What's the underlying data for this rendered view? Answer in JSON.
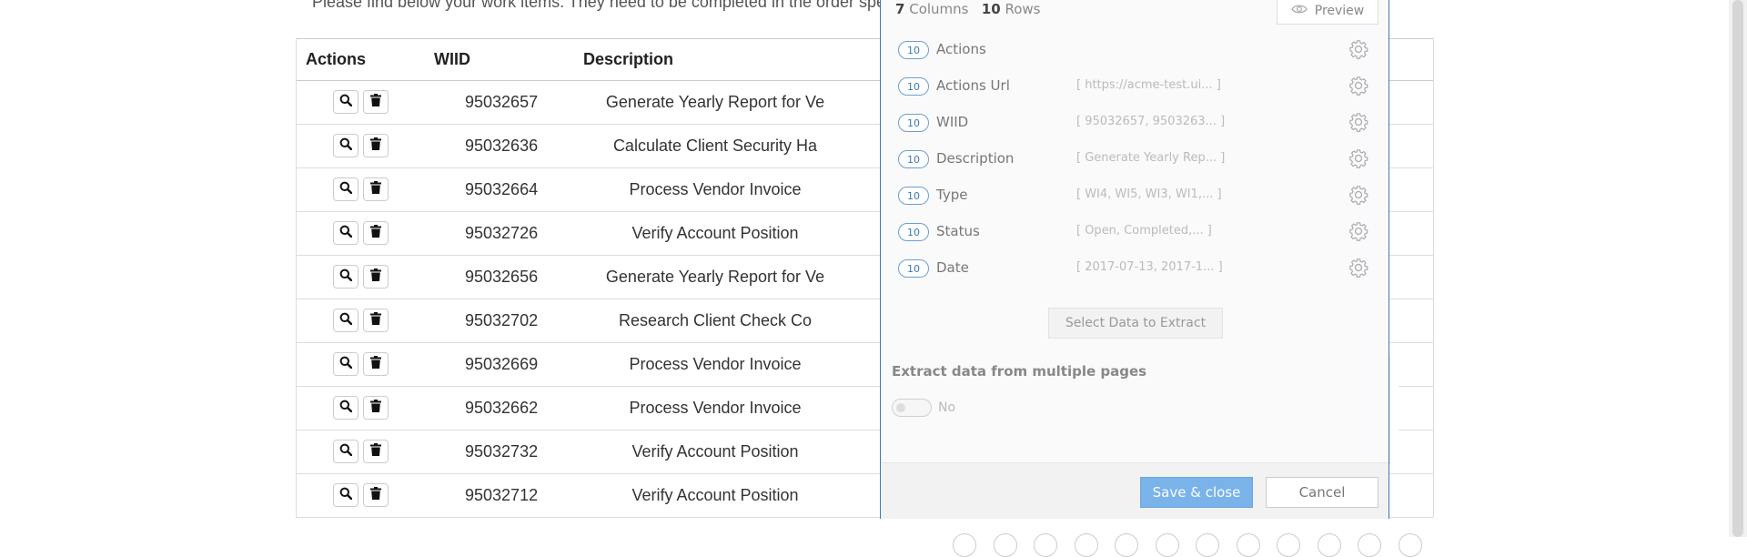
{
  "page": {
    "intro": "Please find below your work items. They need to be completed in the order spec"
  },
  "table": {
    "headers": {
      "actions": "Actions",
      "wiid": "WIID",
      "description": "Description"
    },
    "rows": [
      {
        "wiid": "95032657",
        "description": "Generate Yearly Report for Ve"
      },
      {
        "wiid": "95032636",
        "description": "Calculate Client Security Ha"
      },
      {
        "wiid": "95032664",
        "description": "Process Vendor Invoice"
      },
      {
        "wiid": "95032726",
        "description": "Verify Account Position"
      },
      {
        "wiid": "95032656",
        "description": "Generate Yearly Report for Ve"
      },
      {
        "wiid": "95032702",
        "description": "Research Client Check Co"
      },
      {
        "wiid": "95032669",
        "description": "Process Vendor Invoice"
      },
      {
        "wiid": "95032662",
        "description": "Process Vendor Invoice"
      },
      {
        "wiid": "95032732",
        "description": "Verify Account Position"
      },
      {
        "wiid": "95032712",
        "description": "Verify Account Position"
      }
    ],
    "view_icon": "search-icon",
    "delete_icon": "trash-icon"
  },
  "modal": {
    "columns_count": "7",
    "columns_label": "Columns",
    "rows_count": "10",
    "rows_label": "Rows",
    "preview_label": "Preview",
    "columns": [
      {
        "count": "10",
        "name": "Actions",
        "sample": ""
      },
      {
        "count": "10",
        "name": "Actions Url",
        "sample": "[ https://acme-test.ui...  ]"
      },
      {
        "count": "10",
        "name": "WIID",
        "sample": "[ 95032657, 9503263...  ]"
      },
      {
        "count": "10",
        "name": "Description",
        "sample": "[ Generate Yearly Rep...  ]"
      },
      {
        "count": "10",
        "name": "Type",
        "sample": "[ WI4, WI5, WI3, WI1,...  ]"
      },
      {
        "count": "10",
        "name": "Status",
        "sample": "[ Open, Completed,...   ]"
      },
      {
        "count": "10",
        "name": "Date",
        "sample": "[ 2017-07-13, 2017-1...  ]"
      }
    ],
    "select_data_label": "Select Data to Extract",
    "multi_pages_label": "Extract data from multiple pages",
    "multi_pages_value": "No",
    "save_label": "Save & close",
    "cancel_label": "Cancel"
  },
  "colors": {
    "accent": "#3b78b6",
    "save_button": "#79b3ea"
  }
}
